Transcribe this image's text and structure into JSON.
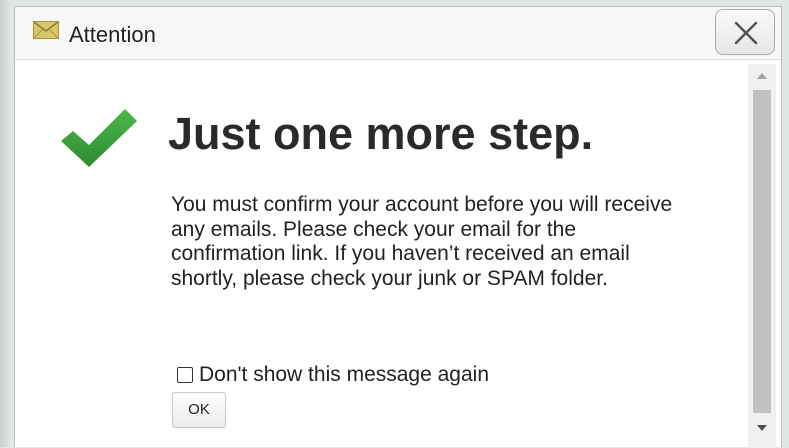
{
  "dialog": {
    "title": "Attention",
    "title_icon": "envelope-icon",
    "close_icon": "close-icon"
  },
  "content": {
    "heading": "Just one more step.",
    "status_icon": "checkmark-icon",
    "message": "You must confirm your account before you will receive any emails. Please check your email for the confirmation link. If you haven’t received an email shortly, please check your junk or SPAM folder."
  },
  "controls": {
    "dont_show_label": "Don't show this message again",
    "dont_show_checked": false,
    "ok_label": "OK"
  },
  "colors": {
    "checkmark": "#3a9e3a",
    "title_bar": "#f7f7f7",
    "envelope": "#c9b55a"
  }
}
